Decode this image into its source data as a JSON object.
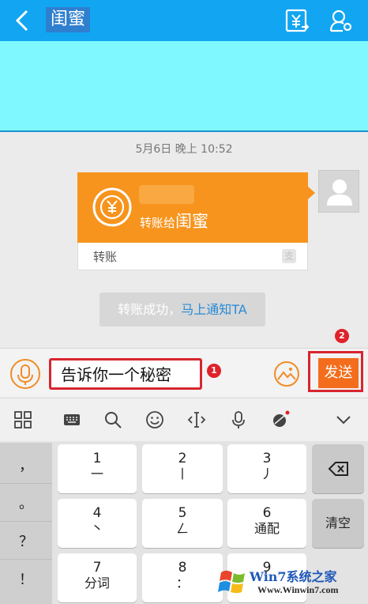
{
  "header": {
    "title": "闺蜜",
    "back_icon": "chevron-left-icon",
    "transfer_icon": "yuan-transfer-icon",
    "profile_icon": "user-settings-icon"
  },
  "chat": {
    "timestamp": "5月6日 晚上 10:52",
    "transfer_card": {
      "label_prefix": "转账给",
      "label_name": "闺蜜",
      "type_label": "转账",
      "brand_mark": "支"
    },
    "notice": {
      "text": "转账成功，",
      "link": "马上通知TA"
    }
  },
  "input_bar": {
    "message_value": "告诉你一个秘密",
    "badge_1": "1",
    "badge_2": "2",
    "send_label": "发送"
  },
  "keyboard": {
    "side_keys": [
      "，",
      "。",
      "？",
      "！"
    ],
    "keys": [
      {
        "num": "1",
        "sub": "一"
      },
      {
        "num": "2",
        "sub": "丨"
      },
      {
        "num": "3",
        "sub": "丿"
      },
      {
        "num": "4",
        "sub": "丶"
      },
      {
        "num": "5",
        "sub": "ㄥ"
      },
      {
        "num": "6",
        "sub": "通配"
      },
      {
        "num": "7",
        "sub": "分词"
      },
      {
        "num": "8",
        "sub": "："
      },
      {
        "num": "9",
        "sub": ""
      }
    ],
    "clear_label": "清空",
    "backspace_icon": "backspace-icon"
  },
  "watermark": {
    "title": "Win7系统之家",
    "url": "Www.Winwin7.com"
  },
  "colors": {
    "header": "#12a5f1",
    "banner": "#7ff9ff",
    "accent_orange": "#f7941d",
    "send": "#f36d1c",
    "annotation_red": "#d8262e",
    "link_blue": "#2a8bd6"
  }
}
